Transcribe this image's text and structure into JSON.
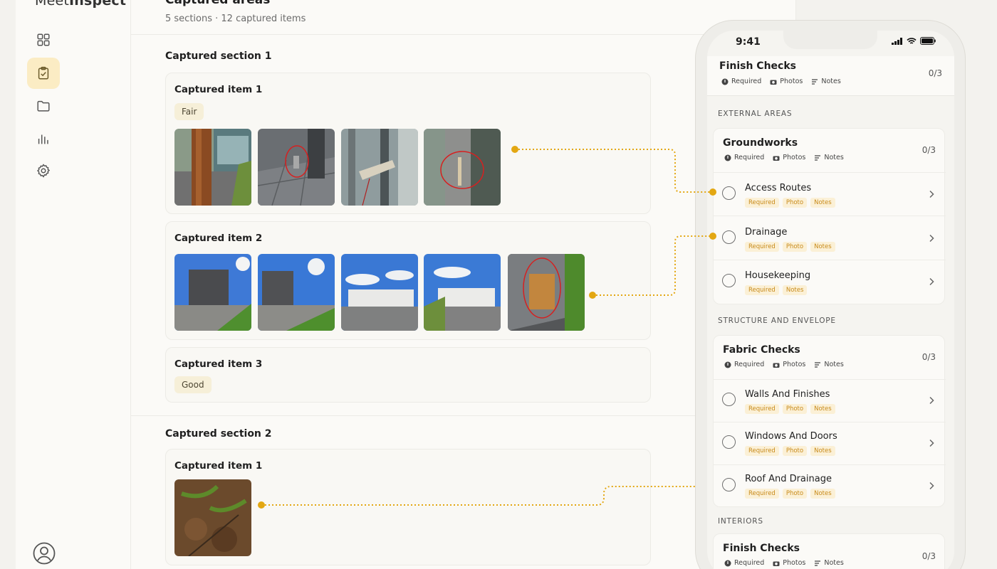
{
  "app": {
    "logo_light": "Meet",
    "logo_bold": "Inspect"
  },
  "sidebar": {
    "items": [
      {
        "icon": "grid-icon"
      },
      {
        "icon": "clipboard-check-icon",
        "active": true
      },
      {
        "icon": "folder-icon"
      },
      {
        "icon": "bar-chart-icon"
      },
      {
        "icon": "gear-icon"
      }
    ],
    "user_icon": "user-circle-icon"
  },
  "main": {
    "title": "Captured areas",
    "subtitle": "5 sections · 12 captured items",
    "sections": [
      {
        "title": "Captured section 1",
        "items": [
          {
            "title": "Captured item 1",
            "badge": "Fair",
            "photos": 4
          },
          {
            "title": "Captured item 2",
            "photos": 5
          },
          {
            "title": "Captured item 3",
            "badge": "Good",
            "photos": 0
          }
        ]
      },
      {
        "title": "Captured section 2",
        "items": [
          {
            "title": "Captured item 1",
            "photos": 1
          }
        ]
      }
    ]
  },
  "phone": {
    "status_time": "9:41",
    "header": {
      "title": "Finish Checks",
      "count": "0/3"
    },
    "meta": {
      "required": "Required",
      "photos": "Photos",
      "notes": "Notes"
    },
    "tags": {
      "required": "Required",
      "photo": "Photo",
      "notes": "Notes"
    },
    "sections": [
      {
        "label": "EXTERNAL AREAS",
        "group": {
          "title": "Groundworks",
          "count": "0/3",
          "rows": [
            {
              "label": "Access Routes"
            },
            {
              "label": "Drainage"
            },
            {
              "label": "Housekeeping"
            }
          ]
        }
      },
      {
        "label": "STRUCTURE AND ENVELOPE",
        "group": {
          "title": "Fabric Checks",
          "count": "0/3",
          "rows": [
            {
              "label": "Walls And Finishes"
            },
            {
              "label": "Windows And Doors"
            },
            {
              "label": "Roof And Drainage"
            }
          ]
        }
      },
      {
        "label": "INTERIORS",
        "group": {
          "title": "Finish Checks",
          "count": "0/3"
        }
      }
    ]
  },
  "colors": {
    "accent": "#e3a712",
    "active_nav": "#fbecc4",
    "tag_text": "#c88a19",
    "tag_bg": "#fbf0d6"
  }
}
